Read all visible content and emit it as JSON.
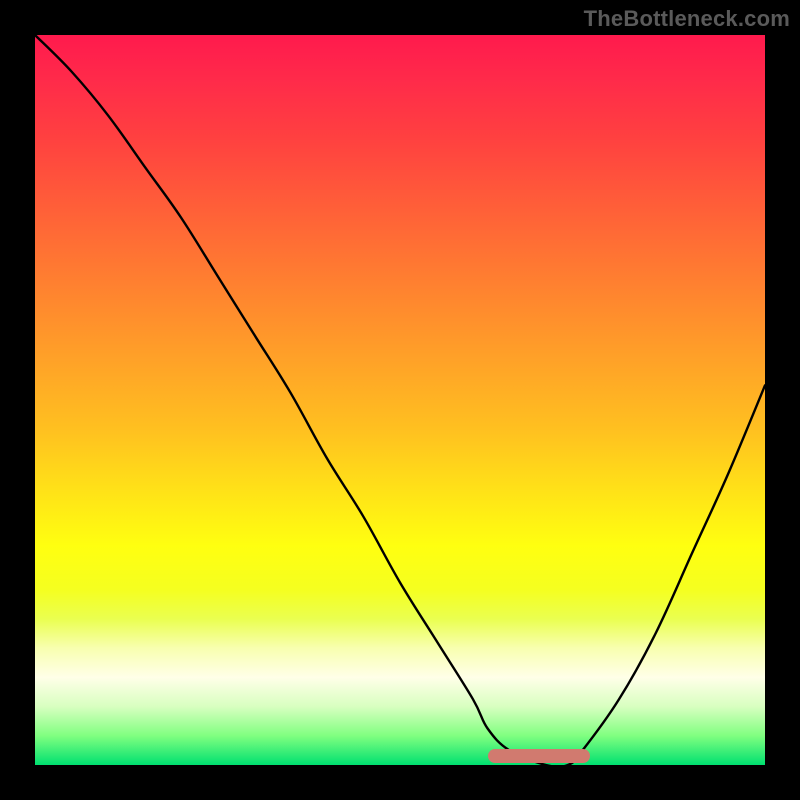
{
  "watermark": "TheBottleneck.com",
  "colors": {
    "frame": "#000000",
    "curve": "#000000",
    "valley_marker": "#d17a6f"
  },
  "chart_data": {
    "type": "line",
    "title": "",
    "xlabel": "",
    "ylabel": "",
    "xlim": [
      0,
      100
    ],
    "ylim": [
      0,
      100
    ],
    "grid": false,
    "legend": false,
    "series": [
      {
        "name": "bottleneck-curve",
        "x": [
          0,
          5,
          10,
          15,
          20,
          25,
          30,
          35,
          40,
          45,
          50,
          55,
          60,
          62,
          65,
          70,
          73,
          75,
          80,
          85,
          90,
          95,
          100
        ],
        "values": [
          100,
          95,
          89,
          82,
          75,
          67,
          59,
          51,
          42,
          34,
          25,
          17,
          9,
          5,
          2,
          0,
          0,
          2,
          9,
          18,
          29,
          40,
          52
        ]
      }
    ],
    "annotations": [
      {
        "name": "valley-marker",
        "x_start": 62,
        "x_end": 76,
        "y": 1,
        "color": "#d17a6f"
      }
    ]
  }
}
